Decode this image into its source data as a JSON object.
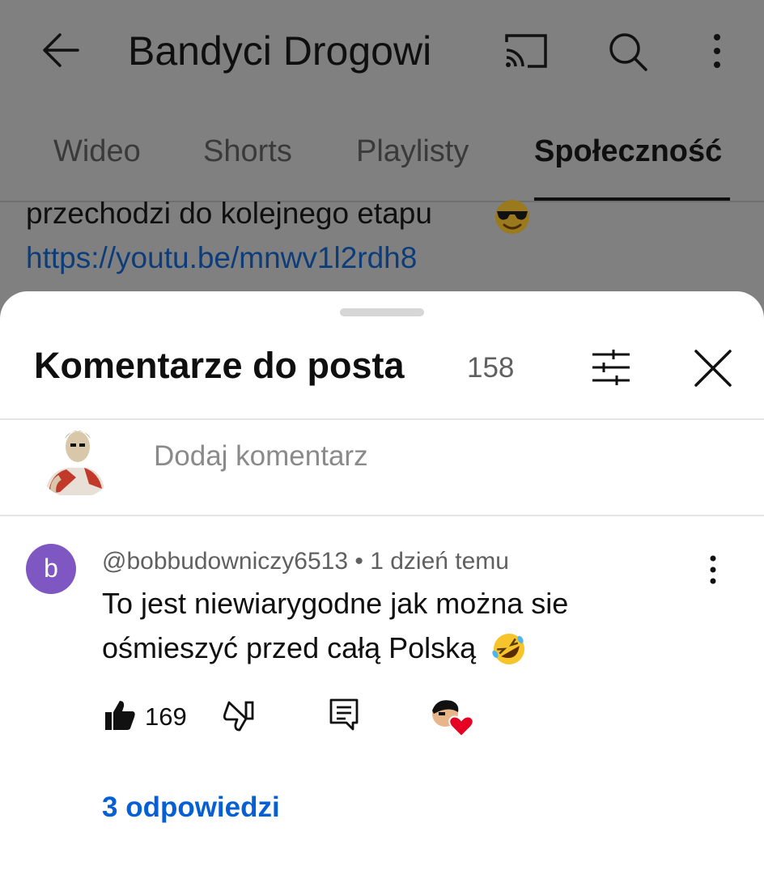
{
  "header": {
    "channel_title": "Bandyci Drogowi",
    "icons": [
      "back-arrow",
      "cast",
      "search",
      "more-vertical"
    ]
  },
  "tabs": [
    {
      "label": "Wideo",
      "active": false
    },
    {
      "label": "Shorts",
      "active": false
    },
    {
      "label": "Playlisty",
      "active": false
    },
    {
      "label": "Społeczność",
      "active": true
    }
  ],
  "post": {
    "text_line": "przechodzi do kolejnego etapu",
    "link": "https://youtu.be/mnwv1l2rdh8",
    "emoji": "smiling-face-with-sunglasses"
  },
  "comments_sheet": {
    "title": "Komentarze do posta",
    "count": "158",
    "add_comment_placeholder": "Dodaj komentarz"
  },
  "comment": {
    "avatar_letter": "b",
    "author": "@bobbudowniczy6513",
    "separator": "•",
    "time": "1 dzień temu",
    "text_line_1": "To jest niewiarygodne jak można sie",
    "text_line_2": "ośmieszyć przed całą Polską",
    "emoji": "rolling-on-the-floor-laughing",
    "likes": "169",
    "creator_hearted": true,
    "replies_label": "3 odpowiedzi"
  },
  "colors": {
    "overlay": "#808080",
    "link": "#065fd4",
    "avatar_purple": "#7e57c2",
    "heart_red": "#e60023"
  }
}
